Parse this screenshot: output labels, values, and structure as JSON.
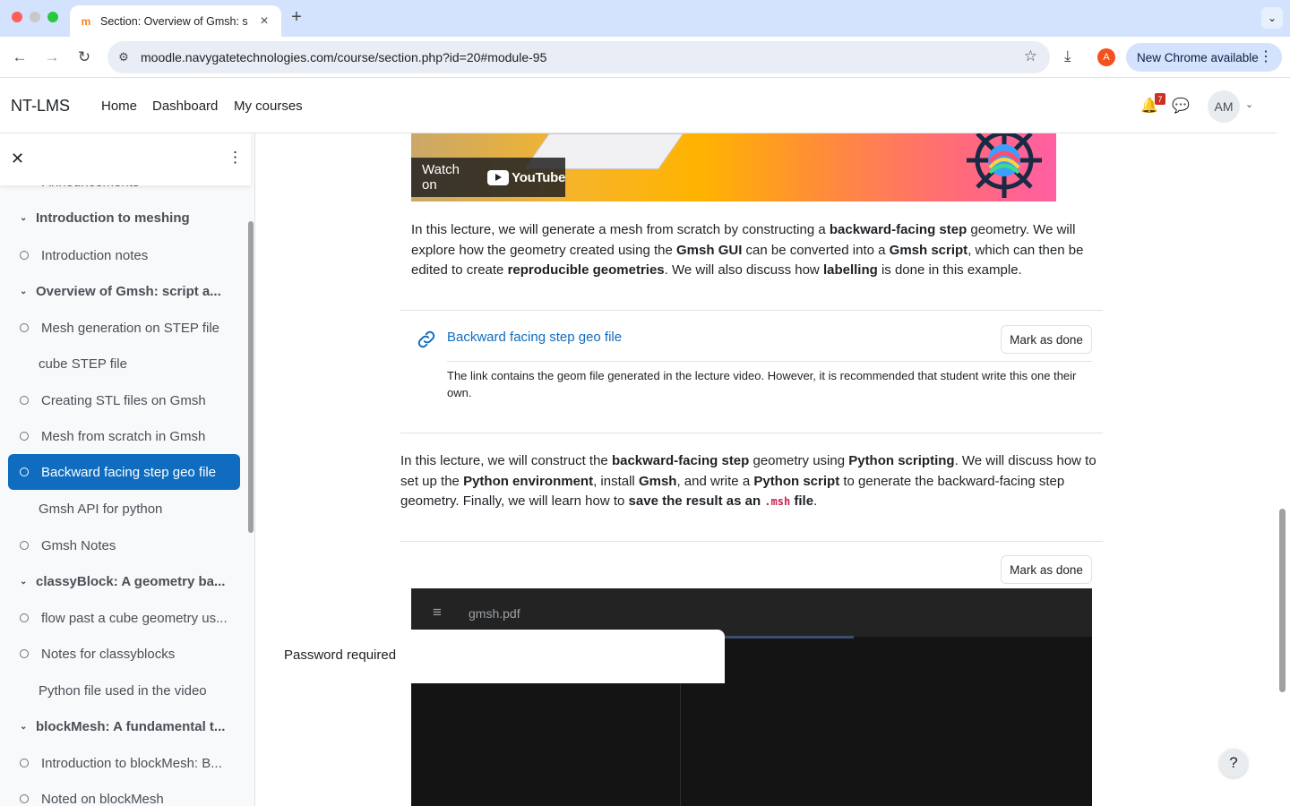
{
  "browser": {
    "tab_title": "Section: Overview of Gmsh: s",
    "favicon": "m",
    "url": "moodle.navygatetechnologies.com/course/section.php?id=20#module-95",
    "profile_initial": "A",
    "update_label": "New Chrome available"
  },
  "navbar": {
    "brand": "NT-LMS",
    "links": [
      "Home",
      "Dashboard",
      "My courses"
    ],
    "notification_count": "7",
    "user_initials": "AM"
  },
  "course_index": {
    "cut_item": "Announcements",
    "sections": [
      {
        "title": "Introduction to meshing"
      },
      {
        "title": "Overview of Gmsh: script a..."
      },
      {
        "title": "classyBlock: A geometry ba..."
      },
      {
        "title": "blockMesh: A fundamental t..."
      }
    ],
    "items": [
      "Introduction notes",
      "Mesh generation on STEP file",
      "cube STEP file",
      "Creating STL files on Gmsh",
      "Mesh from scratch in Gmsh",
      "Backward facing step geo file",
      "Gmsh API for python",
      "Gmsh Notes",
      "flow past a cube geometry us...",
      "Notes for classyblocks",
      "Python file used in the video",
      "Introduction to blockMesh: B...",
      "Noted on blockMesh"
    ]
  },
  "video": {
    "watch_on": "Watch on",
    "youtube": "YouTube"
  },
  "lecture1": {
    "t1": "In this lecture, we will generate a mesh from scratch by constructing a ",
    "b1": "backward-facing step",
    "t2": " geometry. We will explore how the geometry created using the ",
    "b2": "Gmsh GUI",
    "t3": " can be converted into a ",
    "b3": "Gmsh script",
    "t4": ", which can then be edited to create ",
    "b4": "reproducible geometries",
    "t5": ". We will also discuss how ",
    "b5": "labelling",
    "t6": " is done in this example."
  },
  "url_activity": {
    "title": "Backward facing step geo file",
    "button": "Mark as done",
    "description": "The link contains the geom file generated in the lecture video. However, it is recommended that student write this one their own."
  },
  "lecture2": {
    "t1": "In this lecture, we will construct the ",
    "b1": "backward-facing step",
    "t2": " geometry using ",
    "b2": "Python scripting",
    "t3": ". We will discuss how to set up the ",
    "b3": "Python environment",
    "t4": ", install ",
    "b4": "Gmsh",
    "t5": ", and write a ",
    "b5": "Python script",
    "t6": " to generate the backward-facing step geometry. Finally, we will learn how to ",
    "b6": "save the result as an",
    "code": ".msh",
    "b7": "file",
    "t7": "."
  },
  "resource": {
    "button": "Mark as done",
    "pdf_name": "gmsh.pdf",
    "dialog_title": "Password required"
  },
  "help": "?"
}
